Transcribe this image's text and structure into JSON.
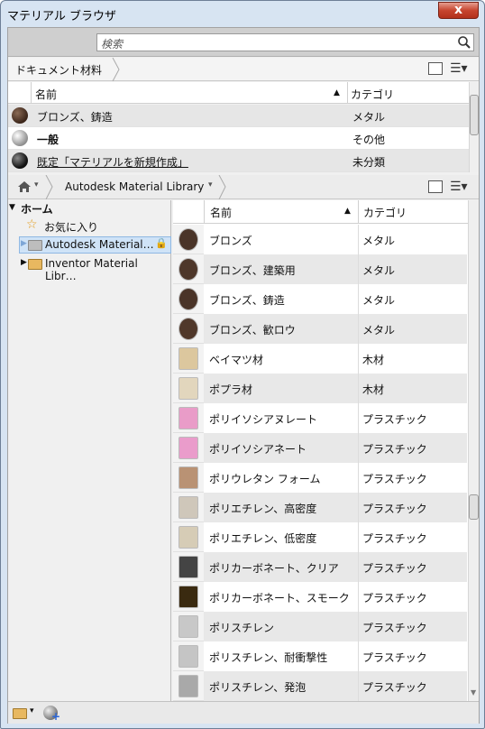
{
  "window": {
    "title": "マテリアル ブラウザ",
    "close": "x"
  },
  "search": {
    "placeholder": "検索"
  },
  "document_panel": {
    "breadcrumb": "ドキュメント材料",
    "col_name": "名前",
    "col_category": "カテゴリ",
    "rows": [
      {
        "name": "ブロンズ、鋳造",
        "category": "メタル"
      },
      {
        "name": "一般",
        "category": "その他"
      },
      {
        "name": "既定「マテリアルを新規作成」",
        "category": "未分類"
      }
    ]
  },
  "library_bar": {
    "breadcrumb": "Autodesk Material Library"
  },
  "tree": {
    "home": "ホーム",
    "favorites": "お気に入り",
    "lib1": "Autodesk Material…",
    "lib2": "Inventor Material Libr…"
  },
  "library_panel": {
    "col_name": "名前",
    "col_category": "カテゴリ",
    "rows": [
      {
        "name": "ブロンズ",
        "category": "メタル",
        "swatch": "#4a3428"
      },
      {
        "name": "ブロンズ、建築用",
        "category": "メタル",
        "swatch": "#4e372a"
      },
      {
        "name": "ブロンズ、鋳造",
        "category": "メタル",
        "swatch": "#4a3428"
      },
      {
        "name": "ブロンズ、歓ロウ",
        "category": "メタル",
        "swatch": "#50382a"
      },
      {
        "name": "ベイマツ材",
        "category": "木材",
        "swatch": "#dcc79e"
      },
      {
        "name": "ポプラ材",
        "category": "木材",
        "swatch": "#e2d6bd"
      },
      {
        "name": "ポリイソシアヌレート",
        "category": "プラスチック",
        "swatch": "#e99cc8"
      },
      {
        "name": "ポリイソシアネート",
        "category": "プラスチック",
        "swatch": "#ea9ccb"
      },
      {
        "name": "ポリウレタン フォーム",
        "category": "プラスチック",
        "swatch": "#b99274"
      },
      {
        "name": "ポリエチレン、高密度",
        "category": "プラスチック",
        "swatch": "#cfc7ba"
      },
      {
        "name": "ポリエチレン、低密度",
        "category": "プラスチック",
        "swatch": "#d6ccb6"
      },
      {
        "name": "ポリカーボネート、クリア",
        "category": "プラスチック",
        "swatch": "#444444"
      },
      {
        "name": "ポリカーボネート、スモーク",
        "category": "プラスチック",
        "swatch": "#3a2a10"
      },
      {
        "name": "ポリスチレン",
        "category": "プラスチック",
        "swatch": "#c8c8c8"
      },
      {
        "name": "ポリスチレン、耐衝撃性",
        "category": "プラスチック",
        "swatch": "#c5c5c5"
      },
      {
        "name": "ポリスチレン、発泡",
        "category": "プラスチック",
        "swatch": "#a9a9a9"
      }
    ]
  }
}
